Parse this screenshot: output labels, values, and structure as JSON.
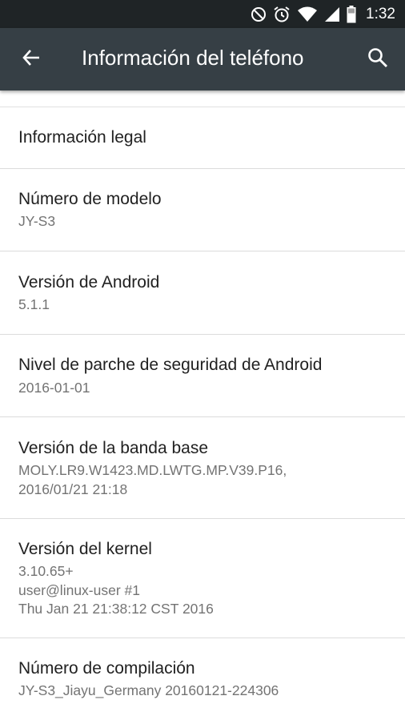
{
  "status_bar": {
    "time": "1:32",
    "icons": [
      "do-not-disturb-icon",
      "alarm-icon",
      "wifi-icon",
      "cell-signal-icon",
      "battery-icon"
    ]
  },
  "app_bar": {
    "title": "Información del teléfono",
    "back_icon": "arrow-back-icon",
    "search_icon": "search-icon",
    "background": "#363f45"
  },
  "items": [
    {
      "title": "Información legal",
      "subtitle": ""
    },
    {
      "title": "Número de modelo",
      "subtitle": "JY-S3"
    },
    {
      "title": "Versión de Android",
      "subtitle": "5.1.1"
    },
    {
      "title": "Nivel de parche de seguridad de Android",
      "subtitle": "2016-01-01"
    },
    {
      "title": "Versión de la banda base",
      "subtitle": "MOLY.LR9.W1423.MD.LWTG.MP.V39.P16,\n2016/01/21 21:18"
    },
    {
      "title": "Versión del kernel",
      "subtitle": "3.10.65+\nuser@linux-user #1\nThu Jan 21 21:38:12 CST 2016"
    },
    {
      "title": "Número de compilación",
      "subtitle": "JY-S3_Jiayu_Germany 20160121-224306"
    }
  ]
}
